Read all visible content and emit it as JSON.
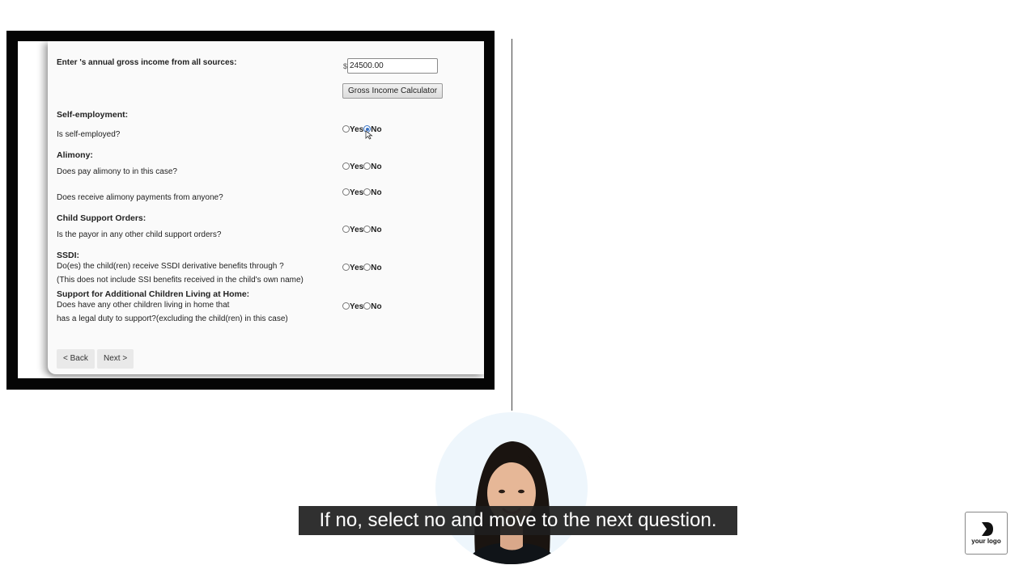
{
  "form": {
    "income_label": "Enter 's annual gross income from all sources:",
    "currency_symbol": "$",
    "income_value": "24500.00",
    "calculator_button": "Gross Income Calculator",
    "yes_label": "Yes",
    "no_label": "No",
    "sections": {
      "self_employment": {
        "header": "Self-employment:",
        "question": "Is self-employed?",
        "selected": "No"
      },
      "alimony": {
        "header": "Alimony:",
        "question_pay": "Does pay alimony to in this case?",
        "selected_pay": null,
        "question_receive": "Does receive alimony payments from anyone?",
        "selected_receive": null
      },
      "child_support": {
        "header": "Child Support Orders:",
        "question": "Is the payor in any other child support orders?",
        "selected": null
      },
      "ssdi": {
        "header": "SSDI:",
        "question_line1": "Do(es) the child(ren) receive SSDI derivative benefits through ?",
        "question_line2": "(This does not include SSI benefits received in the child's own name)",
        "selected": null
      },
      "additional_children": {
        "header": "Support for Additional Children Living at Home:",
        "question_line1": "Does have any other children living in home that",
        "question_line2": "has a legal duty to support?(excluding the child(ren) in this case)",
        "selected": null
      }
    },
    "back_button": "< Back",
    "next_button": "Next >"
  },
  "caption": {
    "text": "If no, select no and move to the next question."
  },
  "logo": {
    "text": "your logo"
  },
  "colors": {
    "radio_selected": "#3b73c4",
    "frame": "#050505",
    "caption_bg": "#1e1e1e"
  }
}
